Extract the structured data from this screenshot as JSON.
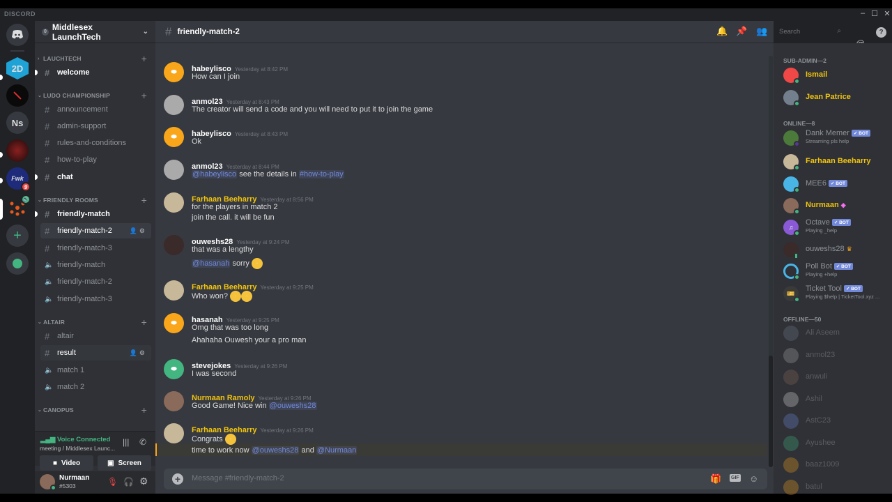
{
  "app": {
    "brand": "DISCORD",
    "window_controls": [
      "–",
      "☐",
      "✕"
    ]
  },
  "guilds": [
    {
      "name": "Home",
      "icon": "discord-logo-icon",
      "color": "#36393f",
      "label": ""
    },
    {
      "name": "2D",
      "color": "#1fa3d6",
      "label": "2D"
    },
    {
      "name": "Red stroke server",
      "color": "#0a0a0a",
      "label": ""
    },
    {
      "name": "Ns",
      "color": "#36393f",
      "label": "Ns"
    },
    {
      "name": "Dark hero server",
      "color": "#5a1a1a",
      "label": ""
    },
    {
      "name": "FWK",
      "color": "#1e2a7a",
      "label": "Fwk",
      "badge": "9"
    },
    {
      "name": "Middlesex LaunchTech",
      "color": "#e8581c",
      "label": "",
      "voice": true
    },
    {
      "name": "Add a Server",
      "label": "+"
    },
    {
      "name": "Explore Public Servers",
      "label": "⊘"
    }
  ],
  "server": {
    "name": "Middlesex LaunchTech",
    "boost": "0"
  },
  "categories": [
    {
      "name": "LAUCHTECH",
      "channels": [
        {
          "name": "welcome",
          "type": "text",
          "unread": true
        }
      ]
    },
    {
      "name": "LUDO CHAMPIONSHIP",
      "channels": [
        {
          "name": "announcement",
          "type": "text"
        },
        {
          "name": "admin-support",
          "type": "text"
        },
        {
          "name": "rules-and-conditions",
          "type": "text"
        },
        {
          "name": "how-to-play",
          "type": "text"
        },
        {
          "name": "chat",
          "type": "text",
          "unread": true
        }
      ]
    },
    {
      "name": "FRIENDLY ROOMS",
      "channels": [
        {
          "name": "friendly-match",
          "type": "text",
          "unread": true
        },
        {
          "name": "friendly-match-2",
          "type": "text",
          "selected": true
        },
        {
          "name": "friendly-match-3",
          "type": "text"
        },
        {
          "name": "friendly-match",
          "type": "voice"
        },
        {
          "name": "friendly-match-2",
          "type": "voice"
        },
        {
          "name": "friendly-match-3",
          "type": "voice"
        }
      ]
    },
    {
      "name": "ALTAIR",
      "channels": [
        {
          "name": "altair",
          "type": "text-locked"
        },
        {
          "name": "result",
          "type": "text-locked",
          "hover": true
        },
        {
          "name": "match 1",
          "type": "voice-locked"
        },
        {
          "name": "match 2",
          "type": "voice-locked"
        }
      ]
    },
    {
      "name": "CANOPUS",
      "channels": []
    }
  ],
  "voice": {
    "status": "Voice Connected",
    "location": "meeting / Middlesex Launc...",
    "video_label": "Video",
    "screen_label": "Screen"
  },
  "user": {
    "name": "Nurmaan",
    "tag": "#5303"
  },
  "chat": {
    "channel": "friendly-match-2",
    "search_placeholder": "Search",
    "composer_placeholder": "Message #friendly-match-2",
    "messages": [
      {
        "author": "habeylisco",
        "ts": "Yesterday at 8:42 PM",
        "avatar_color": "#faa61a",
        "lines": [
          "How can I join"
        ]
      },
      {
        "author": "anmol23",
        "ts": "Yesterday at 8:43 PM",
        "avatar_color": "#aaaaaa",
        "lines": [
          "The creator will send a code and you will need to put it to join the game"
        ]
      },
      {
        "author": "habeylisco",
        "ts": "Yesterday at 8:43 PM",
        "avatar_color": "#faa61a",
        "lines": [
          "Ok"
        ]
      },
      {
        "author": "anmol23",
        "ts": "Yesterday at 8:44 PM",
        "avatar_color": "#aaaaaa",
        "lines": [
          "@habeylisco see the details in #how-to-play"
        ],
        "mention": "@habeylisco",
        "text": " see the details in ",
        "channel_link": "#how-to-play"
      },
      {
        "author": "Farhaan Beeharry",
        "ts": "Yesterday at 8:56 PM",
        "role": true,
        "avatar_color": "#c8b89a",
        "lines": [
          "for the players in match 2",
          "join the call. it will be fun"
        ]
      },
      {
        "author": "ouweshs28",
        "ts": "Yesterday at 9:24 PM",
        "avatar_color": "#3a2a2a",
        "lines": [
          "that was a lengthy",
          "sorry"
        ],
        "mention": "@hasanah",
        "emoji": "🙁"
      },
      {
        "author": "Farhaan Beeharry",
        "ts": "Yesterday at 9:25 PM",
        "role": true,
        "avatar_color": "#c8b89a",
        "lines": [
          "Who won?"
        ],
        "emoji": "🤣🤣"
      },
      {
        "author": "hasanah",
        "ts": "Yesterday at 9:25 PM",
        "avatar_color": "#faa61a",
        "lines": [
          "Omg that was too long",
          "Ahahaha Ouwesh your a pro man"
        ]
      },
      {
        "author": "stevejokes",
        "ts": "Yesterday at 9:26 PM",
        "avatar_color": "#43b581",
        "lines": [
          "I was second"
        ]
      },
      {
        "author": "Nurmaan Ramoly",
        "ts": "Yesterday at 9:26 PM",
        "role": true,
        "avatar_color": "#8a6a5a",
        "lines": [
          "Good Game! Nice win"
        ],
        "mention": "@ouweshs28"
      },
      {
        "author": "Farhaan Beeharry",
        "ts": "Yesterday at 9:26 PM",
        "role": true,
        "avatar_color": "#c8b89a",
        "lines": [
          "Congrats",
          "time to work now"
        ],
        "emoji": "😄",
        "mention": "@ouweshs28",
        "and": "and",
        "mention2": "@Nurmaan"
      }
    ]
  },
  "members": {
    "groups": [
      {
        "title": "SUB-ADMIN—2",
        "members": [
          {
            "name": "Ismail",
            "role": true,
            "color": "#f04747"
          },
          {
            "name": "Jean Patrice",
            "role": true,
            "color": "#747f8d"
          }
        ]
      },
      {
        "title": "ONLINE—8",
        "members": [
          {
            "name": "Dank Memer",
            "bot": "✓ BOT",
            "sub": "Streaming pls help",
            "color": "#4c7a3a",
            "status": "streaming"
          },
          {
            "name": "Farhaan Beeharry",
            "role": true,
            "color": "#c8b89a"
          },
          {
            "name": "MEE6",
            "bot": "✓ BOT",
            "color": "#49b5e7"
          },
          {
            "name": "Nurmaan",
            "role": true,
            "badge": "◈",
            "color": "#8a6a5a"
          },
          {
            "name": "Octave",
            "bot": "✓ BOT",
            "sub": "Playing _help",
            "color": "#8a5ad6"
          },
          {
            "name": "ouweshs28",
            "badge": "♛",
            "color": "#3a2a2a",
            "status": "mobile"
          },
          {
            "name": "Poll Bot",
            "bot": "✓ BOT",
            "sub": "Playing +help",
            "color": "#2f8fd6"
          },
          {
            "name": "Ticket Tool",
            "bot": "✓ BOT",
            "sub": "Playing $help | TicketTool.xyz ...",
            "color": "#3a3a3a"
          }
        ]
      },
      {
        "title": "OFFLINE—50",
        "members": [
          {
            "name": "Ali Aseem",
            "color": "#747f8d"
          },
          {
            "name": "anmol23",
            "color": "#aaaaaa"
          },
          {
            "name": "anwuli",
            "color": "#8a6a5a"
          },
          {
            "name": "Ashil",
            "color": "#dddddd"
          },
          {
            "name": "AstC23",
            "color": "#7289da"
          },
          {
            "name": "Ayushee",
            "color": "#43b581"
          },
          {
            "name": "baaz1009",
            "color": "#faa61a"
          },
          {
            "name": "batul",
            "color": "#faa61a"
          }
        ]
      }
    ]
  }
}
